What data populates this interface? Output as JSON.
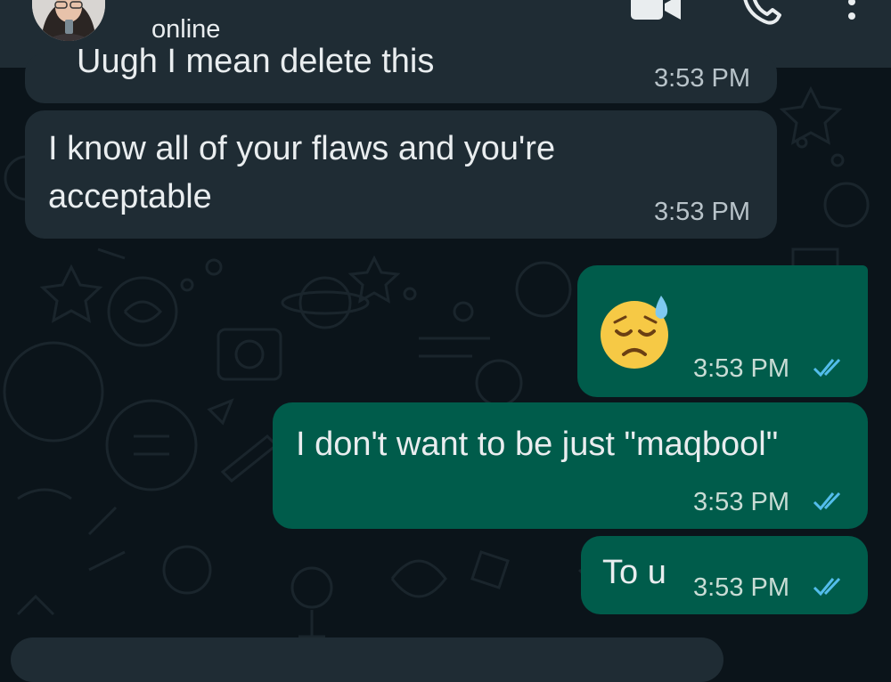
{
  "header": {
    "status": "online",
    "avatar_icon": "contact-avatar",
    "video_icon": "video-call-icon",
    "call_icon": "phone-icon",
    "menu_icon": "more-vert-icon"
  },
  "messages": [
    {
      "direction": "incoming",
      "text": "Uugh I mean delete this",
      "time": "3:53 PM",
      "cut_off": true
    },
    {
      "direction": "incoming",
      "line1": "I know all of your flaws and you're",
      "line2": "acceptable",
      "time": "3:53 PM"
    },
    {
      "direction": "outgoing",
      "emoji": "😓",
      "time": "3:53 PM",
      "read_receipt": "double-check-icon"
    },
    {
      "direction": "outgoing",
      "text": "I don't want to be just \"maqbool\"",
      "time": "3:53 PM",
      "read_receipt": "double-check-icon"
    },
    {
      "direction": "outgoing",
      "text": "To u",
      "time": "3:53 PM",
      "read_receipt": "double-check-icon"
    }
  ],
  "colors": {
    "background": "#0b141a",
    "header": "#1f2c34",
    "incoming_bubble": "#1f2c34",
    "outgoing_bubble": "#005c4b",
    "read_tick": "#53bdeb"
  }
}
